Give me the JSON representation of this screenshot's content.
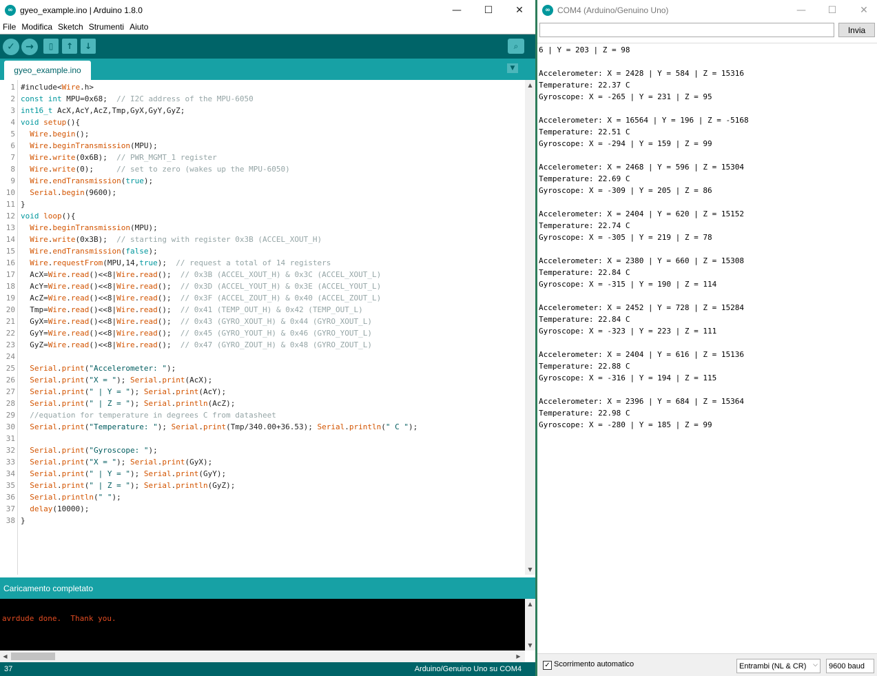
{
  "ide": {
    "title": "gyeo_example.ino | Arduino 1.8.0",
    "menus": [
      "File",
      "Modifica",
      "Sketch",
      "Strumenti",
      "Aiuto"
    ],
    "toolbar": {
      "verify_icon": "checkmark-icon",
      "upload_icon": "arrow-right-icon",
      "new_icon": "new-file-icon",
      "open_icon": "arrow-up-icon",
      "save_icon": "arrow-down-icon",
      "serial_monitor_icon": "magnifier-icon"
    },
    "tab_label": "gyeo_example.ino",
    "code_lines": [
      "#include<Wire.h>",
      "const int MPU=0x68;  // I2C address of the MPU-6050",
      "int16_t AcX,AcY,AcZ,Tmp,GyX,GyY,GyZ;",
      "void setup(){",
      "  Wire.begin();",
      "  Wire.beginTransmission(MPU);",
      "  Wire.write(0x6B);  // PWR_MGMT_1 register",
      "  Wire.write(0);     // set to zero (wakes up the MPU-6050)",
      "  Wire.endTransmission(true);",
      "  Serial.begin(9600);",
      "}",
      "void loop(){",
      "  Wire.beginTransmission(MPU);",
      "  Wire.write(0x3B);  // starting with register 0x3B (ACCEL_XOUT_H)",
      "  Wire.endTransmission(false);",
      "  Wire.requestFrom(MPU,14,true);  // request a total of 14 registers",
      "  AcX=Wire.read()<<8|Wire.read();  // 0x3B (ACCEL_XOUT_H) & 0x3C (ACCEL_XOUT_L)",
      "  AcY=Wire.read()<<8|Wire.read();  // 0x3D (ACCEL_YOUT_H) & 0x3E (ACCEL_YOUT_L)",
      "  AcZ=Wire.read()<<8|Wire.read();  // 0x3F (ACCEL_ZOUT_H) & 0x40 (ACCEL_ZOUT_L)",
      "  Tmp=Wire.read()<<8|Wire.read();  // 0x41 (TEMP_OUT_H) & 0x42 (TEMP_OUT_L)",
      "  GyX=Wire.read()<<8|Wire.read();  // 0x43 (GYRO_XOUT_H) & 0x44 (GYRO_XOUT_L)",
      "  GyY=Wire.read()<<8|Wire.read();  // 0x45 (GYRO_YOUT_H) & 0x46 (GYRO_YOUT_L)",
      "  GyZ=Wire.read()<<8|Wire.read();  // 0x47 (GYRO_ZOUT_H) & 0x48 (GYRO_ZOUT_L)",
      "",
      "  Serial.print(\"Accelerometer: \");",
      "  Serial.print(\"X = \"); Serial.print(AcX);",
      "  Serial.print(\" | Y = \"); Serial.print(AcY);",
      "  Serial.print(\" | Z = \"); Serial.println(AcZ);",
      "  //equation for temperature in degrees C from datasheet",
      "  Serial.print(\"Temperature: \"); Serial.print(Tmp/340.00+36.53); Serial.println(\" C \");",
      "",
      "  Serial.print(\"Gyroscope: \");",
      "  Serial.print(\"X = \"); Serial.print(GyX);",
      "  Serial.print(\" | Y = \"); Serial.print(GyY);",
      "  Serial.print(\" | Z = \"); Serial.println(GyZ);",
      "  Serial.println(\" \");",
      "  delay(10000);",
      "}"
    ],
    "status_message": "Caricamento completato",
    "console_output": "avrdude done.  Thank you.",
    "footer_line": "37",
    "footer_board": "Arduino/Genuino Uno su COM4"
  },
  "serial": {
    "title": "COM4 (Arduino/Genuino Uno)",
    "input_value": "",
    "send_label": "Invia",
    "output_lines": [
      "6 | Y = 203 | Z = 98",
      "",
      "Accelerometer: X = 2428 | Y = 584 | Z = 15316",
      "Temperature: 22.37 C",
      "Gyroscope: X = -265 | Y = 231 | Z = 95",
      "",
      "Accelerometer: X = 16564 | Y = 196 | Z = -5168",
      "Temperature: 22.51 C",
      "Gyroscope: X = -294 | Y = 159 | Z = 99",
      "",
      "Accelerometer: X = 2468 | Y = 596 | Z = 15304",
      "Temperature: 22.69 C",
      "Gyroscope: X = -309 | Y = 205 | Z = 86",
      "",
      "Accelerometer: X = 2404 | Y = 620 | Z = 15152",
      "Temperature: 22.74 C",
      "Gyroscope: X = -305 | Y = 219 | Z = 78",
      "",
      "Accelerometer: X = 2380 | Y = 660 | Z = 15308",
      "Temperature: 22.84 C",
      "Gyroscope: X = -315 | Y = 190 | Z = 114",
      "",
      "Accelerometer: X = 2452 | Y = 728 | Z = 15284",
      "Temperature: 22.84 C",
      "Gyroscope: X = -323 | Y = 223 | Z = 111",
      "",
      "Accelerometer: X = 2404 | Y = 616 | Z = 15136",
      "Temperature: 22.88 C",
      "Gyroscope: X = -316 | Y = 194 | Z = 115",
      "",
      "Accelerometer: X = 2396 | Y = 684 | Z = 15364",
      "Temperature: 22.98 C",
      "Gyroscope: X = -280 | Y = 185 | Z = 99"
    ],
    "autoscroll_label": "Scorrimento automatico",
    "autoscroll_checked": true,
    "line_ending": "Entrambi (NL & CR)",
    "baud": "9600 baud"
  },
  "colors": {
    "arduino_teal": "#00979c",
    "toolbar_dark": "#006468",
    "tabstrip": "#17a1a5",
    "console_text": "#e34c22"
  }
}
